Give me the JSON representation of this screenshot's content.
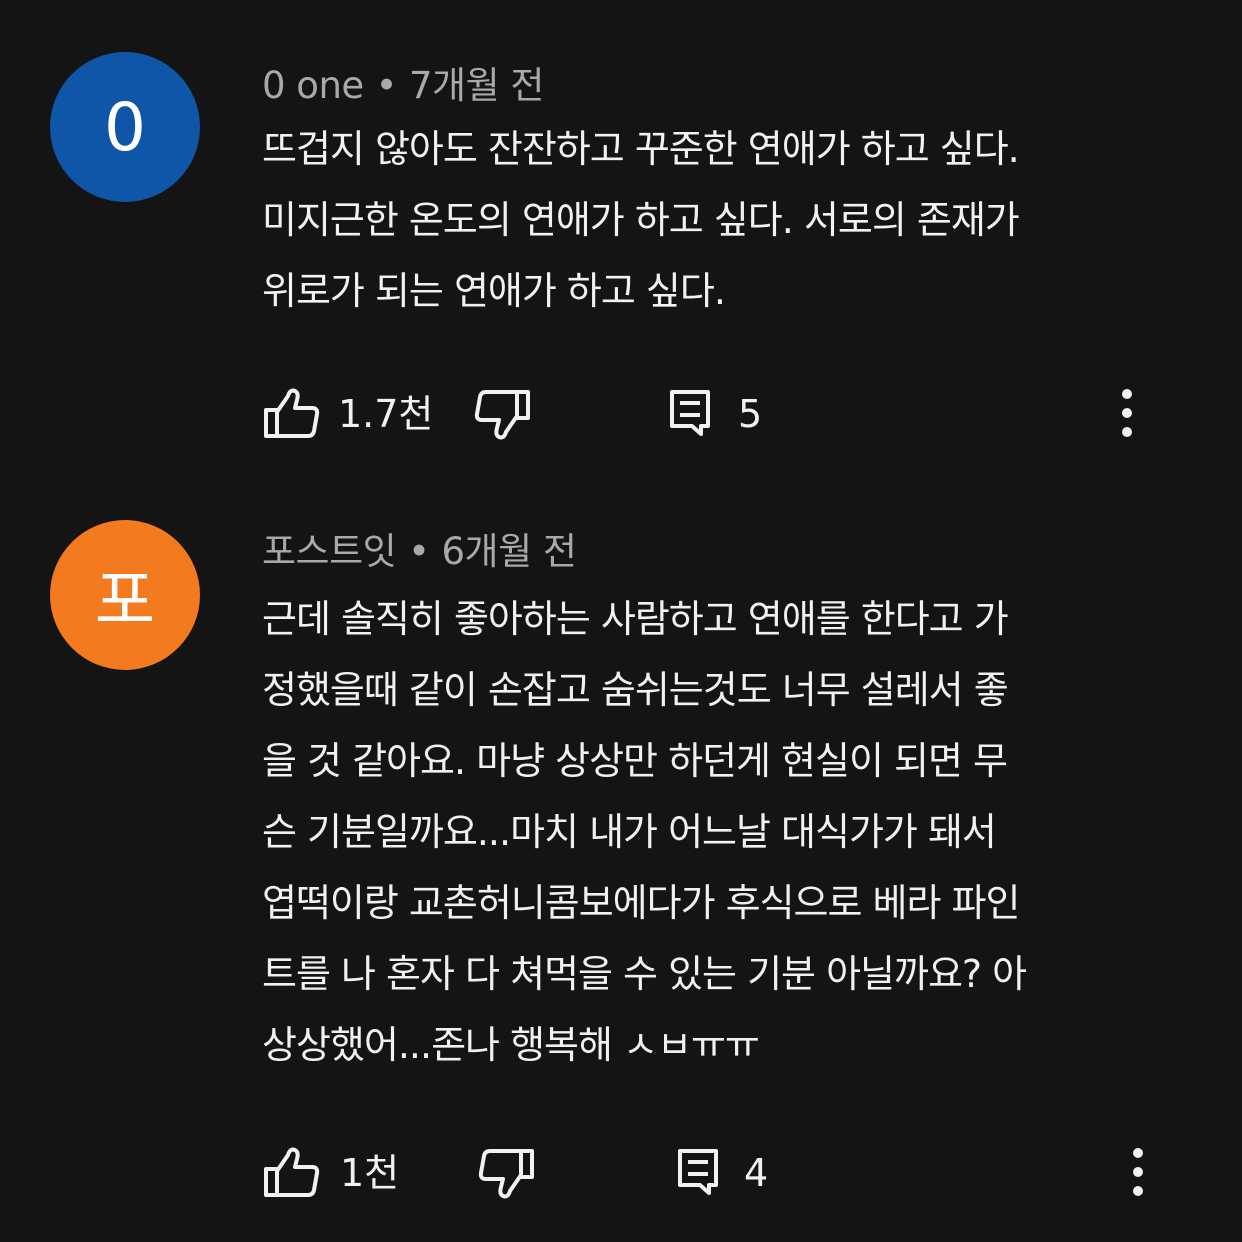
{
  "comments": [
    {
      "avatar_letter": "0",
      "avatar_color": "#0f56a8",
      "author": "0 one",
      "separator": "•",
      "time": "7개월 전",
      "text": "뜨겁지 않아도 잔잔하고 꾸준한 연애가 하고 싶다.\n미지근한 온도의 연애가 하고 싶다. 서로의 존재가\n위로가 되는 연애가 하고 싶다.",
      "likes": "1.7천",
      "replies": "5"
    },
    {
      "avatar_letter": "포",
      "avatar_color": "#f47a1f",
      "author": "포스트잇",
      "separator": "•",
      "time": "6개월 전",
      "text": "근데 솔직히 좋아하는 사람하고 연애를 한다고 가\n정했을때 같이 손잡고 숨쉬는것도 너무 설레서 좋\n을 것 같아요. 마냥 상상만 하던게 현실이 되면 무\n슨 기분일까요...마치 내가 어느날 대식가가 돼서\n엽떡이랑 교촌허니콤보에다가 후식으로 베라 파인\n트를 나 혼자 다 쳐먹을 수 있는 기분 아닐까요? 아\n상상했어...존나 행복해 ㅅㅂㅠㅠ",
      "likes": "1천",
      "replies": "4"
    }
  ],
  "icons": {
    "like": "thumbs-up-icon",
    "dislike": "thumbs-down-icon",
    "reply": "reply-icon",
    "more": "more-vertical-icon"
  }
}
